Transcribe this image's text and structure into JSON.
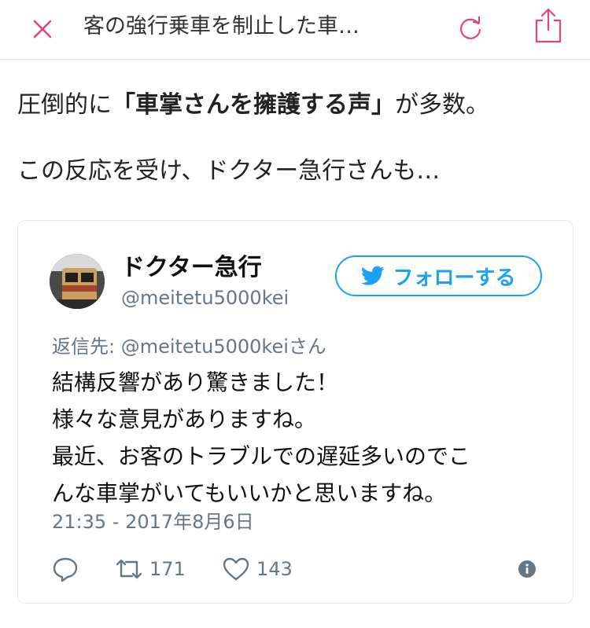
{
  "header": {
    "title": "客の強行乗車を制止した車…",
    "icons": {
      "close": "close-icon",
      "reload": "reload-icon",
      "share": "share-icon"
    },
    "accent": "#e0457b"
  },
  "article": {
    "para1_before": "圧倒的に",
    "para1_bold": "「車掌さんを擁護する声」",
    "para1_after": "が多数。",
    "para2": "この反応を受け、ドクター急行さんも…"
  },
  "tweet": {
    "display_name": "ドクター急行",
    "handle": "@meitetu5000kei",
    "follow_label": "フォローする",
    "reply_to": "返信先: @meitetu5000keiさん",
    "text": "結構反響があり驚きました！\n様々な意見がありますね。\n最近、お客のトラブルでの遅延多いのでこ\nんな車掌がいてもいいかと思いますね。",
    "timestamp": "21:35 - 2017年8月6日",
    "retweets": "171",
    "likes": "143",
    "twitter_blue": "#1da1f2",
    "muted": "#657786"
  }
}
